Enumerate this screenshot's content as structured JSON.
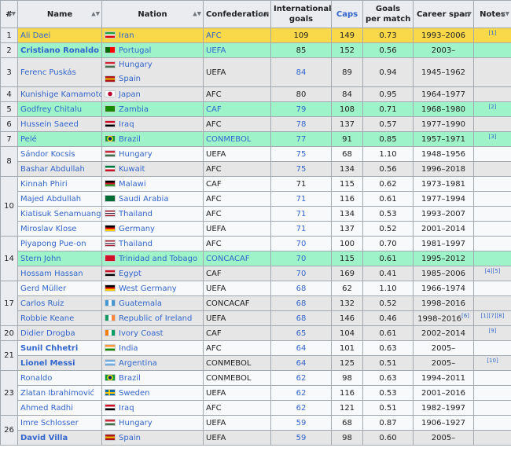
{
  "headers": {
    "rank": "#",
    "name": "Name",
    "nation": "Nation",
    "confed": "Confederation",
    "goals_l1": "International",
    "goals_l2": "goals",
    "caps": "Caps",
    "gpm_l1": "Goals",
    "gpm_l2": "per match",
    "span": "Career span",
    "notes": "Notes"
  },
  "rows": [
    {
      "rank": "1",
      "name": "Ali Daei",
      "nation": "Iran",
      "confed": "AFC",
      "goals": "109",
      "caps": "149",
      "gpm": "0.73",
      "span": "1993–2006",
      "notes": "[1]"
    },
    {
      "rank": "2",
      "name": "Cristiano Ronaldo",
      "nation": "Portugal",
      "confed": "UEFA",
      "goals": "85",
      "caps": "152",
      "gpm": "0.56",
      "span": "2003–",
      "notes": ""
    },
    {
      "rank": "3",
      "name": "Ferenc Puskás",
      "nation": "Hungary",
      "nation2": "Spain",
      "confed": "UEFA",
      "goals": "84",
      "caps": "89",
      "gpm": "0.94",
      "span": "1945–1962",
      "notes": ""
    },
    {
      "rank": "4",
      "name": "Kunishige Kamamoto",
      "nation": "Japan",
      "confed": "AFC",
      "goals": "80",
      "caps": "84",
      "gpm": "0.95",
      "span": "1964–1977",
      "notes": ""
    },
    {
      "rank": "5",
      "name": "Godfrey Chitalu",
      "nation": "Zambia",
      "confed": "CAF",
      "goals": "79",
      "caps": "108",
      "gpm": "0.71",
      "span": "1968–1980",
      "notes": "[2]"
    },
    {
      "rank": "6",
      "name": "Hussein Saeed",
      "nation": "Iraq",
      "confed": "AFC",
      "goals": "78",
      "caps": "137",
      "gpm": "0.57",
      "span": "1977–1990",
      "notes": ""
    },
    {
      "rank": "7",
      "name": "Pelé",
      "nation": "Brazil",
      "confed": "CONMEBOL",
      "goals": "77",
      "caps": "91",
      "gpm": "0.85",
      "span": "1957–1971",
      "notes": "[3]"
    },
    {
      "rank": "8",
      "name": "Sándor Kocsis",
      "nation": "Hungary",
      "confed": "UEFA",
      "goals": "75",
      "caps": "68",
      "gpm": "1.10",
      "span": "1948–1956",
      "notes": ""
    },
    {
      "rank": "",
      "name": "Bashar Abdullah",
      "nation": "Kuwait",
      "confed": "AFC",
      "goals": "75",
      "caps": "134",
      "gpm": "0.56",
      "span": "1996–2018",
      "notes": ""
    },
    {
      "rank": "10",
      "name": "Kinnah Phiri",
      "nation": "Malawi",
      "confed": "CAF",
      "goals": "71",
      "caps": "115",
      "gpm": "0.62",
      "span": "1973–1981",
      "notes": ""
    },
    {
      "rank": "",
      "name": "Majed Abdullah",
      "nation": "Saudi Arabia",
      "confed": "AFC",
      "goals": "71",
      "caps": "116",
      "gpm": "0.61",
      "span": "1977–1994",
      "notes": ""
    },
    {
      "rank": "",
      "name": "Kiatisuk Senamuang",
      "nation": "Thailand",
      "confed": "AFC",
      "goals": "71",
      "caps": "134",
      "gpm": "0.53",
      "span": "1993–2007",
      "notes": ""
    },
    {
      "rank": "",
      "name": "Miroslav Klose",
      "nation": "Germany",
      "confed": "UEFA",
      "goals": "71",
      "caps": "137",
      "gpm": "0.52",
      "span": "2001–2014",
      "notes": ""
    },
    {
      "rank": "14",
      "name": "Piyapong Pue-on",
      "nation": "Thailand",
      "confed": "AFC",
      "goals": "70",
      "caps": "100",
      "gpm": "0.70",
      "span": "1981–1997",
      "notes": ""
    },
    {
      "rank": "",
      "name": "Stern John",
      "nation": "Trinidad and Tobago",
      "confed": "CONCACAF",
      "goals": "70",
      "caps": "115",
      "gpm": "0.61",
      "span": "1995–2012",
      "notes": ""
    },
    {
      "rank": "",
      "name": "Hossam Hassan",
      "nation": "Egypt",
      "confed": "CAF",
      "goals": "70",
      "caps": "169",
      "gpm": "0.41",
      "span": "1985–2006",
      "notes": "[4][5]"
    },
    {
      "rank": "17",
      "name": "Gerd Müller",
      "nation": "West Germany",
      "confed": "UEFA",
      "goals": "68",
      "caps": "62",
      "gpm": "1.10",
      "span": "1966–1974",
      "notes": ""
    },
    {
      "rank": "",
      "name": "Carlos Ruiz",
      "nation": "Guatemala",
      "confed": "CONCACAF",
      "goals": "68",
      "caps": "132",
      "gpm": "0.52",
      "span": "1998–2016",
      "notes": ""
    },
    {
      "rank": "",
      "name": "Robbie Keane",
      "nation": "Republic of Ireland",
      "confed": "UEFA",
      "goals": "68",
      "caps": "146",
      "gpm": "0.46",
      "span": "1998–2016",
      "span_sup": "[6]",
      "notes": "[1][7][8]"
    },
    {
      "rank": "20",
      "name": "Didier Drogba",
      "nation": "Ivory Coast",
      "confed": "CAF",
      "goals": "65",
      "caps": "104",
      "gpm": "0.61",
      "span": "2002–2014",
      "notes": "[9]"
    },
    {
      "rank": "21",
      "name": "Sunil Chhetri",
      "nation": "India",
      "confed": "AFC",
      "goals": "64",
      "caps": "101",
      "gpm": "0.63",
      "span": "2005–",
      "notes": ""
    },
    {
      "rank": "",
      "name": "Lionel Messi",
      "nation": "Argentina",
      "confed": "CONMEBOL",
      "goals": "64",
      "caps": "125",
      "gpm": "0.51",
      "span": "2005–",
      "notes": "[10]"
    },
    {
      "rank": "23",
      "name": "Ronaldo",
      "nation": "Brazil",
      "confed": "CONMEBOL",
      "goals": "62",
      "caps": "98",
      "gpm": "0.63",
      "span": "1994–2011",
      "notes": ""
    },
    {
      "rank": "",
      "name": "Zlatan Ibrahimović",
      "nation": "Sweden",
      "confed": "UEFA",
      "goals": "62",
      "caps": "116",
      "gpm": "0.53",
      "span": "2001–2016",
      "notes": ""
    },
    {
      "rank": "",
      "name": "Ahmed Radhi",
      "nation": "Iraq",
      "confed": "AFC",
      "goals": "62",
      "caps": "121",
      "gpm": "0.51",
      "span": "1982–1997",
      "notes": ""
    },
    {
      "rank": "26",
      "name": "Imre Schlosser",
      "nation": "Hungary",
      "confed": "UEFA",
      "goals": "59",
      "caps": "68",
      "gpm": "0.87",
      "span": "1906–1927",
      "notes": ""
    },
    {
      "rank": "",
      "name": "David Villa",
      "nation": "Spain",
      "confed": "UEFA",
      "goals": "59",
      "caps": "98",
      "gpm": "0.60",
      "span": "2005–",
      "notes": ""
    }
  ]
}
